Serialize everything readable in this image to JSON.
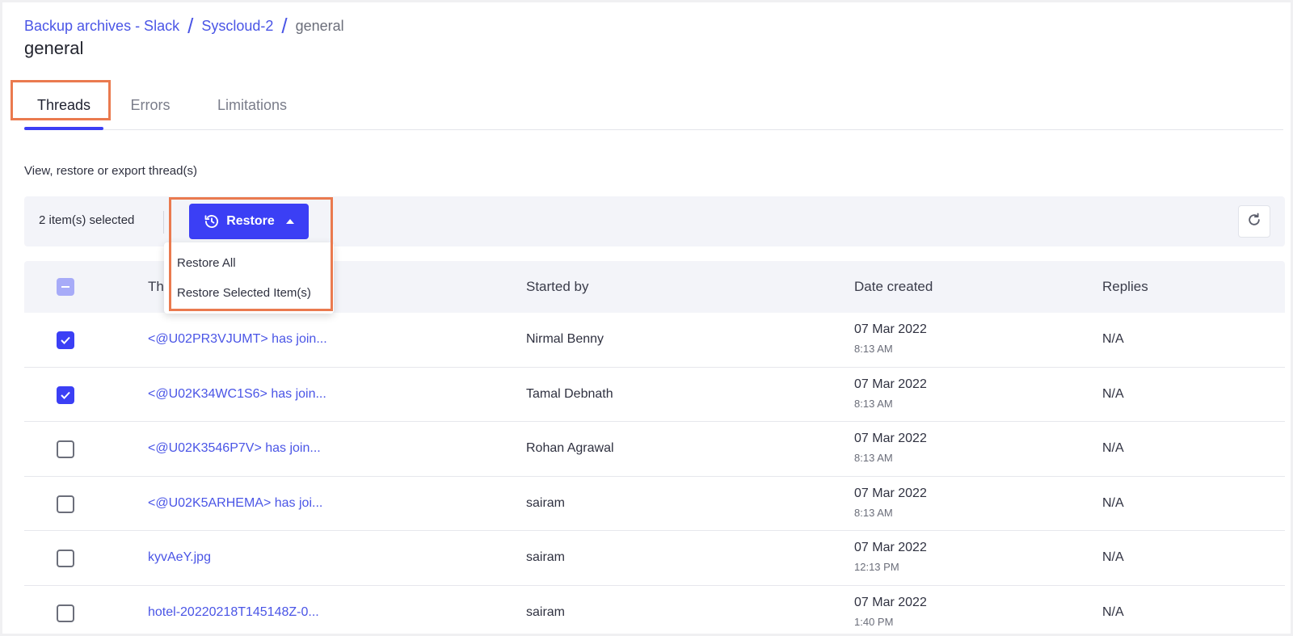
{
  "breadcrumb": {
    "items": [
      "Backup archives - Slack",
      "Syscloud-2"
    ],
    "separator": "/",
    "current": "general"
  },
  "page_title": "general",
  "tabs": [
    {
      "label": "Threads",
      "active": true
    },
    {
      "label": "Errors",
      "active": false
    },
    {
      "label": "Limitations",
      "active": false
    }
  ],
  "subtitle": "View, restore or export thread(s)",
  "toolbar": {
    "selected_text": "2 item(s) selected",
    "restore_label": "Restore",
    "restore_icon": "history-icon",
    "refresh_icon": "refresh-icon"
  },
  "restore_menu": {
    "items": [
      "Restore All",
      "Restore Selected Item(s)"
    ]
  },
  "table": {
    "columns": [
      "Thread",
      "Started by",
      "Date created",
      "Replies"
    ],
    "header_visible_text": "Th",
    "select_all_state": "indeterminate",
    "rows": [
      {
        "checked": true,
        "thread": "<@U02PR3VJUMT> has join...",
        "started_by": "Nirmal Benny",
        "date": "07 Mar 2022",
        "time": "8:13 AM",
        "replies": "N/A"
      },
      {
        "checked": true,
        "thread": "<@U02K34WC1S6> has join...",
        "started_by": "Tamal Debnath",
        "date": "07 Mar 2022",
        "time": "8:13 AM",
        "replies": "N/A"
      },
      {
        "checked": false,
        "thread": "<@U02K3546P7V> has join...",
        "started_by": "Rohan Agrawal",
        "date": "07 Mar 2022",
        "time": "8:13 AM",
        "replies": "N/A"
      },
      {
        "checked": false,
        "thread": "<@U02K5ARHEMA> has joi...",
        "started_by": "sairam",
        "date": "07 Mar 2022",
        "time": "8:13 AM",
        "replies": "N/A"
      },
      {
        "checked": false,
        "thread": "kyvAeY.jpg",
        "started_by": "sairam",
        "date": "07 Mar 2022",
        "time": "12:13 PM",
        "replies": "N/A"
      },
      {
        "checked": false,
        "thread": "hotel-20220218T145148Z-0...",
        "started_by": "sairam",
        "date": "07 Mar 2022",
        "time": "1:40 PM",
        "replies": "N/A"
      }
    ]
  },
  "colors": {
    "accent": "#3b3ff5",
    "link": "#4a55e6",
    "highlight": "#ea7a4f"
  }
}
